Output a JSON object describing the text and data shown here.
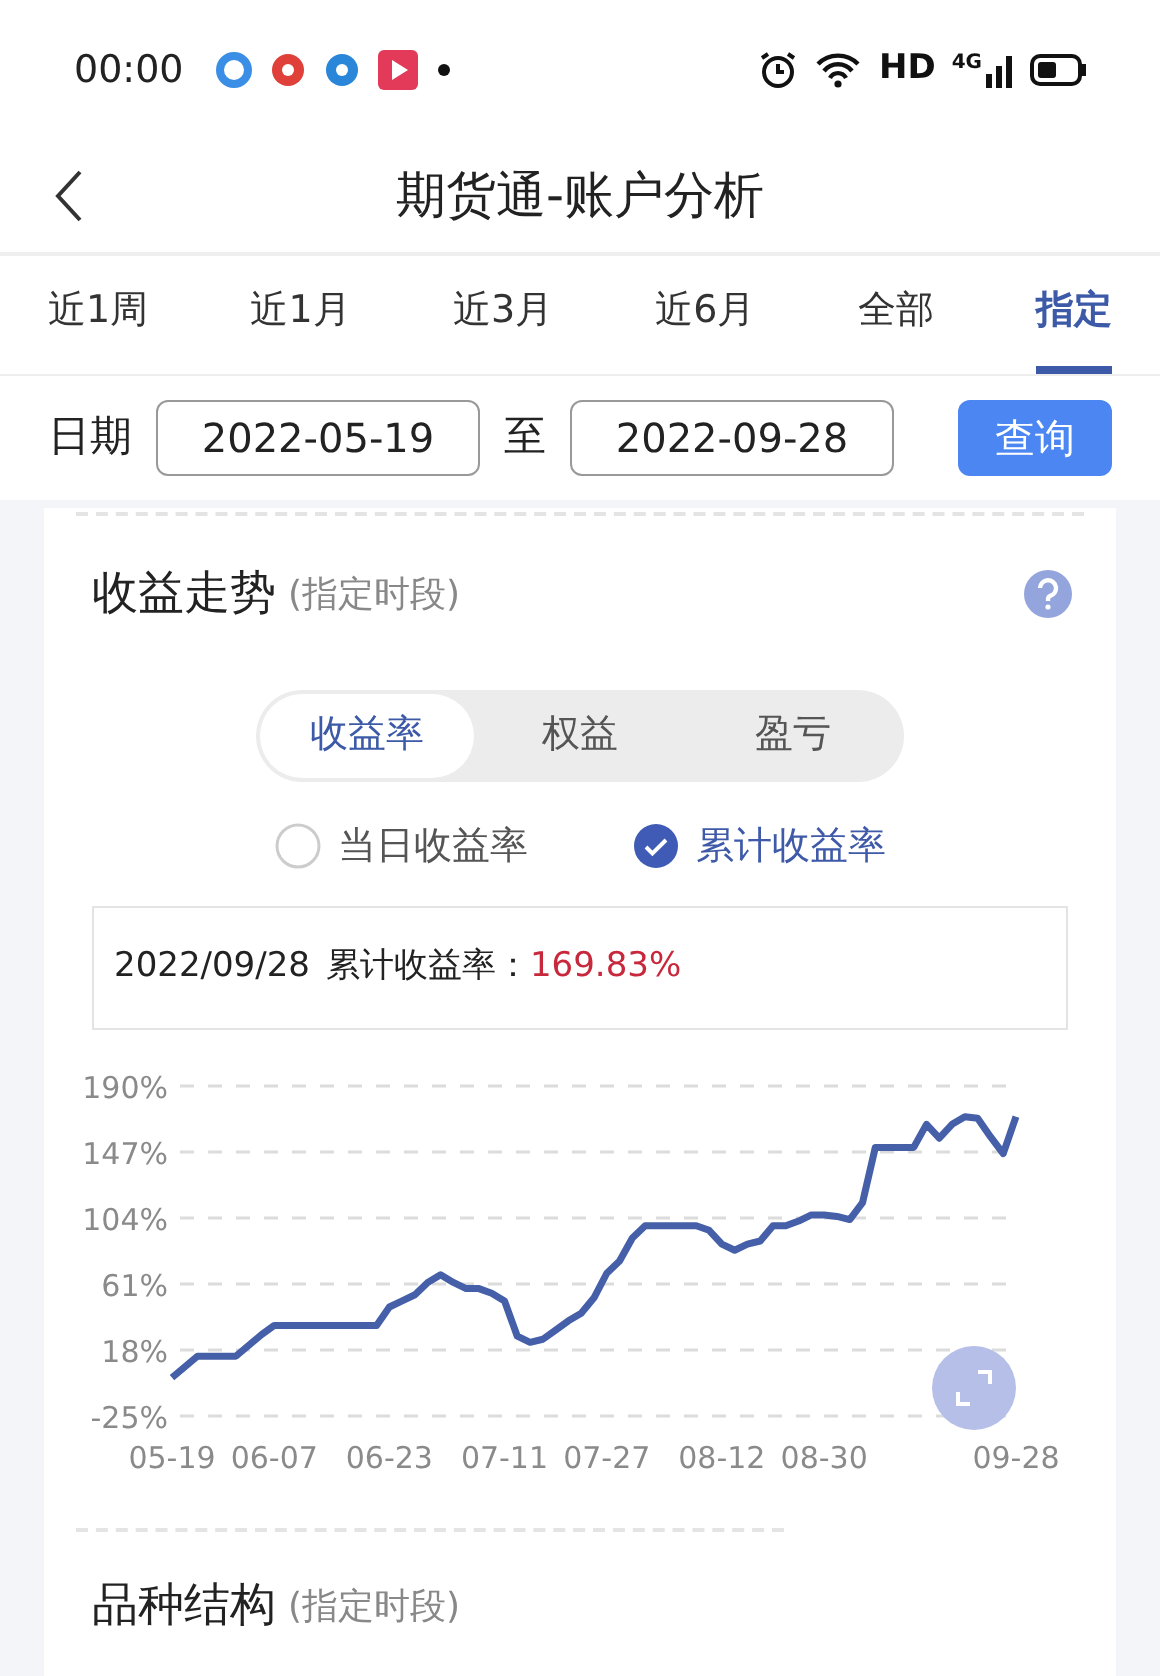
{
  "status_bar": {
    "time": "00:00",
    "network_label": "HD",
    "signal_label": "4G"
  },
  "header": {
    "title": "期货通-账户分析"
  },
  "period_tabs": [
    {
      "label": "近1周",
      "selected": false
    },
    {
      "label": "近1月",
      "selected": false
    },
    {
      "label": "近3月",
      "selected": false
    },
    {
      "label": "近6月",
      "selected": false
    },
    {
      "label": "全部",
      "selected": false
    },
    {
      "label": "指定",
      "selected": true
    }
  ],
  "date_filter": {
    "label": "日期",
    "start": "2022-05-19",
    "separator": "至",
    "end": "2022-09-28",
    "button": "查询"
  },
  "return_trend": {
    "title": "收益走势",
    "subtitle": "(指定时段)",
    "segments": [
      {
        "label": "收益率",
        "selected": true
      },
      {
        "label": "权益",
        "selected": false
      },
      {
        "label": "盈亏",
        "selected": false
      }
    ],
    "options": [
      {
        "label": "当日收益率",
        "selected": false
      },
      {
        "label": "累计收益率",
        "selected": true
      }
    ],
    "summary": {
      "date": "2022/09/28",
      "label": "累计收益率：",
      "value": "169.83%"
    },
    "chart_data": {
      "type": "line",
      "categories": [
        "05-19",
        null,
        null,
        null,
        null,
        null,
        null,
        null,
        "06-07",
        null,
        null,
        null,
        null,
        null,
        null,
        null,
        null,
        "06-23",
        null,
        null,
        null,
        null,
        null,
        null,
        null,
        null,
        "07-11",
        null,
        null,
        null,
        null,
        null,
        null,
        null,
        "07-27",
        null,
        null,
        null,
        null,
        null,
        null,
        null,
        null,
        "08-12",
        null,
        null,
        null,
        null,
        null,
        null,
        null,
        "08-30",
        null,
        null,
        null,
        null,
        null,
        null,
        null,
        null,
        null,
        null,
        null,
        null,
        null,
        null,
        "09-28"
      ],
      "series": [
        {
          "color": "#4560a8",
          "values": [
            0,
            7,
            14,
            14,
            14,
            14,
            21,
            28,
            34,
            34,
            34,
            34,
            34,
            34,
            34,
            34,
            34,
            46,
            50,
            54,
            62,
            67,
            62,
            58,
            58,
            55,
            50,
            27,
            23,
            25,
            31,
            37,
            42,
            52,
            68,
            76,
            91,
            99,
            99,
            99,
            99,
            99,
            96,
            87,
            83,
            87,
            89,
            99,
            99,
            102,
            106,
            106,
            105,
            103,
            114,
            150,
            150,
            150,
            150,
            165,
            156,
            165,
            170,
            169,
            157,
            146,
            170
          ]
        }
      ],
      "ylim": [
        -25,
        190
      ],
      "grid": true,
      "yticks": [
        {
          "value": -25,
          "label": "-25%"
        },
        {
          "value": 18,
          "label": "18%"
        },
        {
          "value": 61,
          "label": "61%"
        },
        {
          "value": 104,
          "label": "104%"
        },
        {
          "value": 147,
          "label": "147%"
        },
        {
          "value": 190,
          "label": "190%"
        }
      ]
    }
  },
  "variety_structure": {
    "title": "品种结构",
    "subtitle": "(指定时段)"
  }
}
